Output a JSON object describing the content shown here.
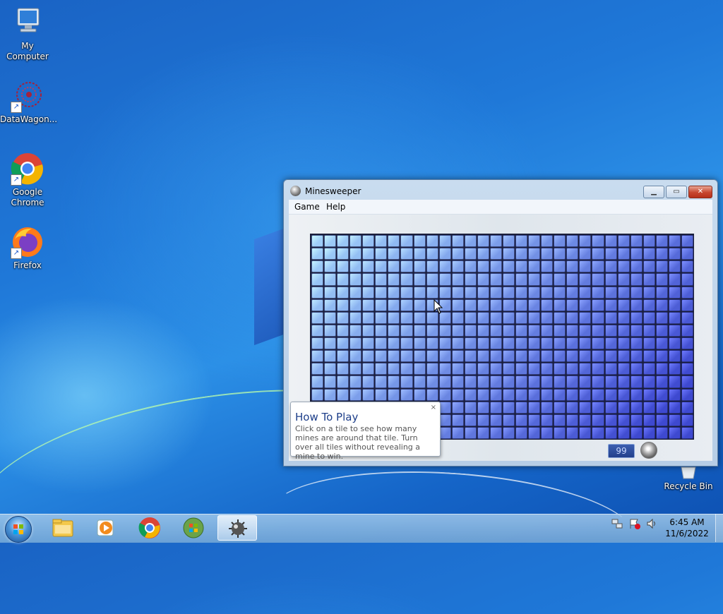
{
  "desktop": {
    "icons": [
      {
        "label": "My Computer",
        "icon": "computer-icon"
      },
      {
        "label": "DataWagon...",
        "icon": "datawagon-icon"
      },
      {
        "label": "Google Chrome",
        "icon": "chrome-icon"
      },
      {
        "label": "Firefox",
        "icon": "firefox-icon"
      },
      {
        "label": "Recycle Bin",
        "icon": "recycle-bin-icon"
      }
    ]
  },
  "window": {
    "title": "Minesweeper",
    "menu": [
      "Game",
      "Help"
    ],
    "mine_counter": "99",
    "board": {
      "rows": 16,
      "cols": 30
    }
  },
  "tooltip": {
    "title": "How To Play",
    "body": "Click on a tile to see how many mines are around that tile. Turn over all tiles without revealing a mine to win.",
    "close": "×"
  },
  "taskbar": {
    "buttons": [
      "start-orb",
      "explorer-icon",
      "media-player-icon",
      "chrome-icon",
      "windows-icon",
      "minesweeper-icon"
    ],
    "active": "minesweeper-icon"
  },
  "clock": {
    "time": "6:45 AM",
    "date": "11/6/2022"
  },
  "colors": {
    "tile_light": "#9ecdf8",
    "tile_dark": "#3e49d0",
    "accent": "#1e3f8a"
  }
}
